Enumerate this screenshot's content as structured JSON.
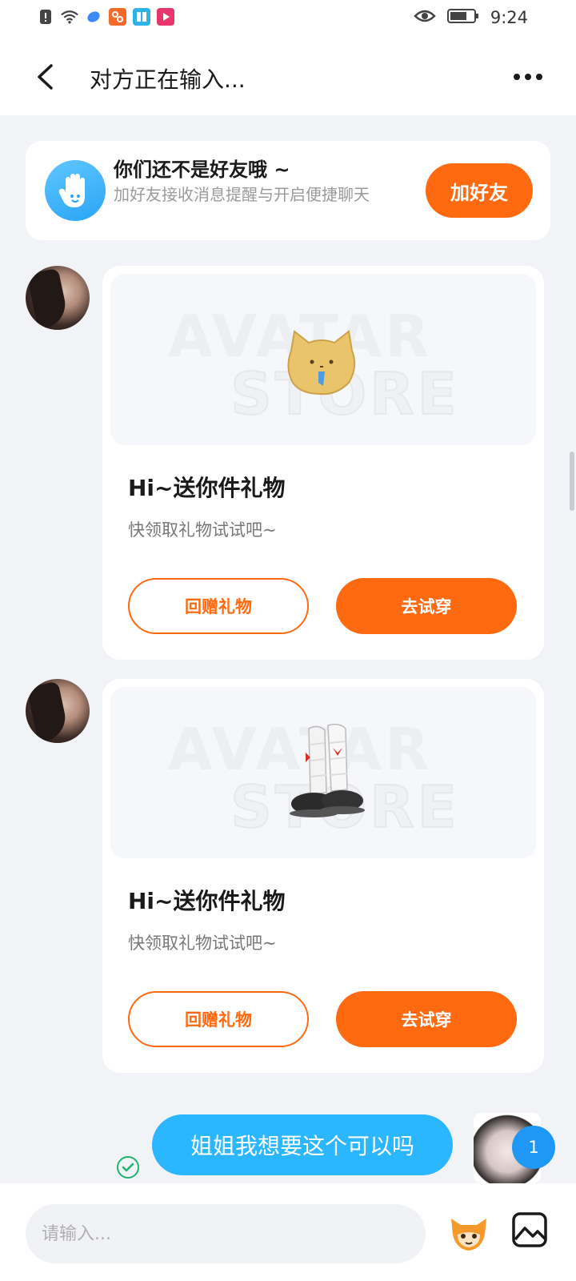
{
  "status_bar": {
    "time": "9:24",
    "icons": [
      "alert-icon",
      "wifi-icon",
      "app-icon-1",
      "app-icon-2",
      "app-icon-3",
      "app-icon-4"
    ],
    "right_icons": [
      "eye-icon",
      "battery-icon"
    ]
  },
  "header": {
    "title": "对方正在输入..."
  },
  "friend_banner": {
    "title": "你们还不是好友哦 ~",
    "description": "加好友接收消息提醒与开启便捷聊天",
    "add_button": "加好友"
  },
  "gift_cards": [
    {
      "title": "Hi~送你件礼物",
      "description": "快领取礼物试试吧~",
      "return_button": "回赠礼物",
      "try_button": "去试穿",
      "watermark_top": "AVATAR",
      "watermark_bottom": "STORE"
    },
    {
      "title": "Hi~送你件礼物",
      "description": "快领取礼物试试吧~",
      "return_button": "回赠礼物",
      "try_button": "去试穿",
      "watermark_top": "AVATAR",
      "watermark_bottom": "STORE"
    }
  ],
  "chat": {
    "outgoing_message": "姐姐我想要这个可以吗",
    "unread_count": "1"
  },
  "input_bar": {
    "placeholder": "请输入..."
  },
  "colors": {
    "accent_orange": "#ff6a10",
    "bubble_blue": "#2ab7ff",
    "badge_blue": "#1f98f5",
    "read_green": "#1fb46e"
  }
}
